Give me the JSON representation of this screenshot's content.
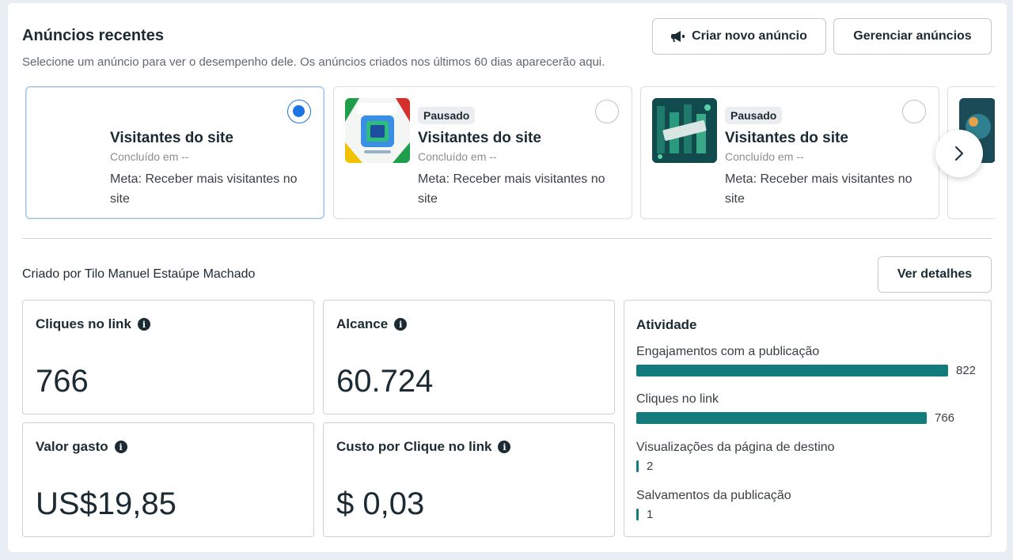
{
  "header": {
    "title": "Anúncios recentes",
    "subtitle": "Selecione um anúncio para ver o desempenho dele. Os anúncios criados nos últimos 60 dias aparecerão aqui.",
    "create_button": "Criar novo anúncio",
    "manage_button": "Gerenciar anúncios"
  },
  "ads": [
    {
      "badge": "",
      "name": "Visitantes do site",
      "ended": "Concluído em --",
      "goal": "Meta: Receber mais visitantes no site",
      "selected": true
    },
    {
      "badge": "Pausado",
      "name": "Visitantes do site",
      "ended": "Concluído em --",
      "goal": "Meta: Receber mais visitantes no site",
      "selected": false
    },
    {
      "badge": "Pausado",
      "name": "Visitantes do site",
      "ended": "Concluído em --",
      "goal": "Meta: Receber mais visitantes no site",
      "selected": false
    }
  ],
  "creator": "Criado por Tilo Manuel Estaúpe Machado",
  "details_button": "Ver detalhes",
  "metrics": [
    {
      "label": "Cliques no link",
      "value": "766"
    },
    {
      "label": "Alcance",
      "value": "60.724"
    },
    {
      "label": "Valor gasto",
      "value": "US$19,85"
    },
    {
      "label": "Custo por Clique no link",
      "value": "$ 0,03"
    }
  ],
  "activity": {
    "title": "Atividade",
    "max": 822,
    "rows": [
      {
        "label": "Engajamentos com a publicação",
        "value": 822,
        "display": "822"
      },
      {
        "label": "Cliques no link",
        "value": 766,
        "display": "766"
      },
      {
        "label": "Visualizações da página de destino",
        "value": 2,
        "display": "2"
      },
      {
        "label": "Salvamentos da publicação",
        "value": 1,
        "display": "1"
      }
    ]
  },
  "colors": {
    "accent": "#1b74e4",
    "bar": "#137b7b"
  },
  "icons": {
    "create": "megaphone-icon",
    "info": "info-icon",
    "next": "chevron-right-icon"
  }
}
